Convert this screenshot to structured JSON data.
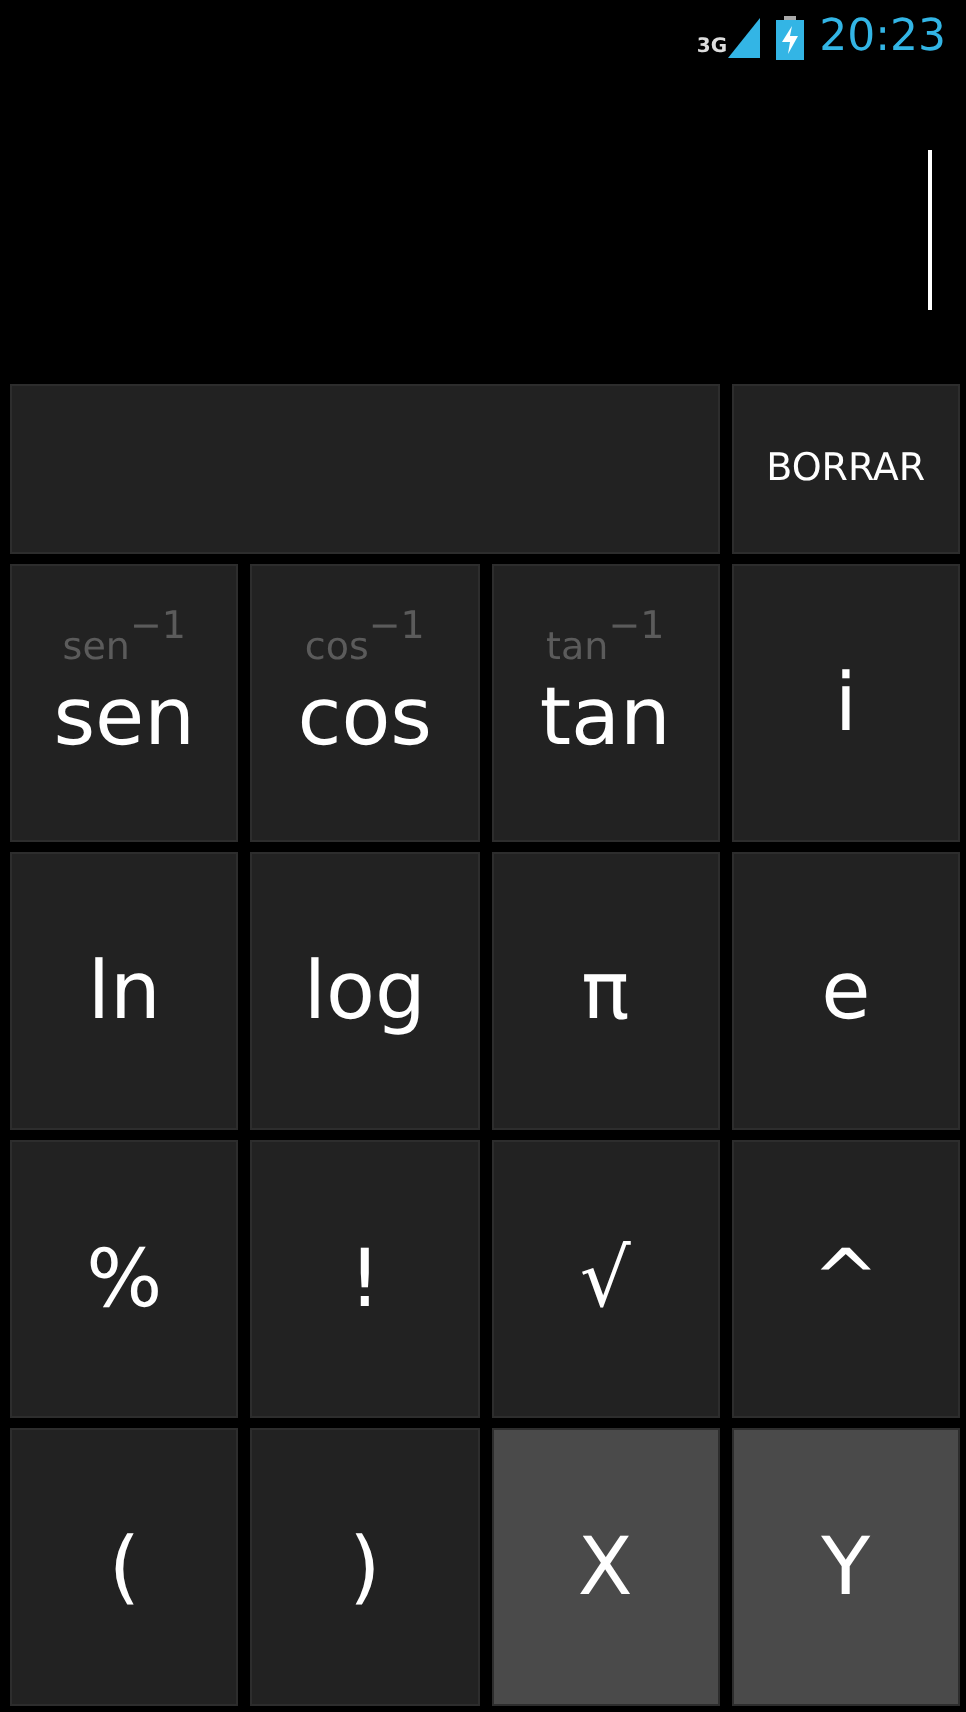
{
  "status_bar": {
    "network": "3G",
    "time": "20:23"
  },
  "display": {
    "cursor": true
  },
  "clear_button": {
    "label": "BORRAR"
  },
  "keys": [
    {
      "label": "sen",
      "alt": "sen$^{−1}$",
      "kind": "normal"
    },
    {
      "label": "cos",
      "alt": "cos$^{−1}$",
      "kind": "normal"
    },
    {
      "label": "tan",
      "alt": "tan$^{−1}$",
      "kind": "normal"
    },
    {
      "label": "i",
      "kind": "normal"
    },
    {
      "label": "ln",
      "kind": "normal"
    },
    {
      "label": "log",
      "kind": "normal"
    },
    {
      "label": "π",
      "kind": "normal"
    },
    {
      "label": "e",
      "kind": "normal"
    },
    {
      "label": "%",
      "kind": "normal"
    },
    {
      "label": "!",
      "kind": "normal"
    },
    {
      "label": "√",
      "kind": "normal"
    },
    {
      "label": "^",
      "kind": "normal"
    },
    {
      "label": "(",
      "kind": "normal"
    },
    {
      "label": ")",
      "kind": "normal"
    },
    {
      "label": "X",
      "kind": "variable"
    },
    {
      "label": "Y",
      "kind": "variable"
    }
  ]
}
